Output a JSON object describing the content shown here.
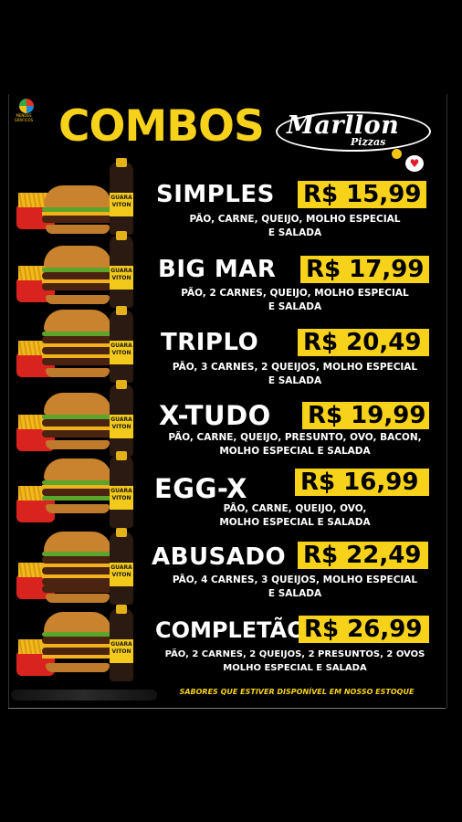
{
  "header": {
    "title": "COMBOS",
    "brand_name": "Marllon",
    "brand_sub": "Pizzas",
    "designer_logo_line1": "MENDES",
    "designer_logo_line2": "GRÁFICOS"
  },
  "items": [
    {
      "name": "SIMPLES",
      "price": "R$ 15,99",
      "desc_line1": "PÃO, CARNE, QUEIJO, MOLHO ESPECIAL",
      "desc_line2": "E SALADA"
    },
    {
      "name": "BIG MAR",
      "price": "R$ 17,99",
      "desc_line1": "PÃO, 2 CARNES, QUEIJO, MOLHO ESPECIAL",
      "desc_line2": "E SALADA"
    },
    {
      "name": "TRIPLO",
      "price": "R$ 20,49",
      "desc_line1": "PÃO, 3 CARNES, 2 QUEIJOS, MOLHO ESPECIAL",
      "desc_line2": "E SALADA"
    },
    {
      "name": "X-TUDO",
      "price": "R$ 19,99",
      "desc_line1": "PÃO, CARNE, QUEIJO, PRESUNTO, OVO, BACON,",
      "desc_line2": "MOLHO ESPECIAL E SALADA"
    },
    {
      "name": "EGG-X",
      "price": "R$ 16,99",
      "desc_line1": "PÃO, CARNE, QUEIJO, OVO,",
      "desc_line2": "MOLHO ESPECIAL E SALADA"
    },
    {
      "name": "ABUSADO",
      "price": "R$ 22,49",
      "desc_line1": "PÃO, 4 CARNES, 3 QUEIJOS, MOLHO ESPECIAL",
      "desc_line2": "E SALADA"
    },
    {
      "name": "COMPLETÃO",
      "price": "R$ 26,99",
      "desc_line1": "PÃO, 2 CARNES, 2 QUEIJOS, 2 PRESUNTOS, 2 OVOS",
      "desc_line2": "MOLHO ESPECIAL E SALADA"
    }
  ],
  "bottle_label": "GUARA VITON",
  "footer": "SABORES QUE ESTIVER DISPONÍVEL EM NOSSO ESTOQUE",
  "colors": {
    "accent": "#f6d21a",
    "background": "#000000",
    "text": "#ffffff"
  }
}
